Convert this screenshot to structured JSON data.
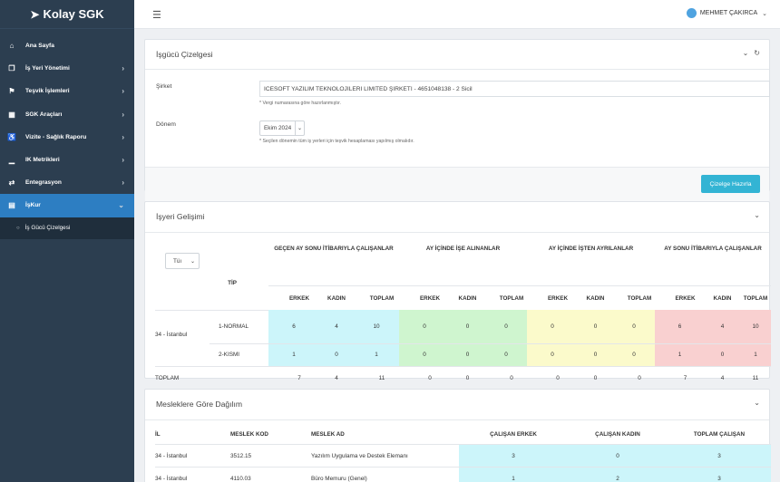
{
  "brand": {
    "name": "Kolay SGK"
  },
  "sidebar": {
    "items": [
      {
        "label": "Ana Sayfa",
        "icon": "home-icon",
        "glyph": "⌂",
        "has_chevron": false
      },
      {
        "label": "İş Yeri Yönetimi",
        "icon": "clipboard-icon",
        "glyph": "❐",
        "has_chevron": true
      },
      {
        "label": "Teşvik İşlemleri",
        "icon": "person-icon",
        "glyph": "⚑",
        "has_chevron": true
      },
      {
        "label": "SGK Araçları",
        "icon": "building-icon",
        "glyph": "▦",
        "has_chevron": true
      },
      {
        "label": "Vizite - Sağlık Raporu",
        "icon": "wheelchair-icon",
        "glyph": "♿",
        "has_chevron": true
      },
      {
        "label": "IK Metrikleri",
        "icon": "chart-icon",
        "glyph": "▁",
        "has_chevron": true
      },
      {
        "label": "Entegrasyon",
        "icon": "exchange-icon",
        "glyph": "⇄",
        "has_chevron": true
      },
      {
        "label": "İşKur",
        "icon": "idcard-icon",
        "glyph": "▤",
        "has_chevron": true,
        "active": true
      }
    ],
    "sub_items": [
      {
        "label": "İş Gücü Çizelgesi"
      }
    ]
  },
  "header": {
    "user_name": "MEHMET ÇAKIRCA"
  },
  "panel1": {
    "title": "İşgücü Çizelgesi",
    "company_label": "Şirket",
    "company_value": "ICESOFT YAZILIM TEKNOLOJILERI LIMITED ŞIRKETI - 4651048138 - 2 Sicil",
    "company_hint": "* Vergi numarasına göre hazırlanmıştır.",
    "period_label": "Dönem",
    "period_value": "Ekim 2024",
    "period_hint": "* Seçilen dönemin tüm iş yerleri için teşvik hesaplaması yapılmış olmalıdır.",
    "prepare_button": "Çizelge Hazırla"
  },
  "panel2": {
    "title": "İşyeri Gelişimi",
    "filter_value": "Tüı",
    "type_header": "TİP",
    "groups": [
      "GEÇEN AY SONU İTİBARIYLA ÇALIŞANLAR",
      "AY İÇİNDE İŞE ALINANLAR",
      "AY İÇİNDE İŞTEN AYRILANLAR",
      "AY SONU İTİBARIYLA ÇALIŞANLAR"
    ],
    "subheaders": [
      "ERKEK",
      "KADIN",
      "TOPLAM"
    ],
    "location": "34 - İstanbul",
    "rows": [
      {
        "type": "1-NORMAL",
        "values": [
          "6",
          "4",
          "10",
          "0",
          "0",
          "0",
          "0",
          "0",
          "0",
          "6",
          "4",
          "10"
        ]
      },
      {
        "type": "2-KISMI",
        "values": [
          "1",
          "0",
          "1",
          "0",
          "0",
          "0",
          "0",
          "0",
          "0",
          "1",
          "0",
          "1"
        ]
      }
    ],
    "total_label": "TOPLAM",
    "totals": [
      "7",
      "4",
      "11",
      "0",
      "0",
      "0",
      "0",
      "0",
      "0",
      "7",
      "4",
      "11"
    ],
    "group_colors": [
      "#ccf5fa",
      "#cff5cf",
      "#fbfacb",
      "#f9d0d0"
    ]
  },
  "panel3": {
    "title": "Mesleklere Göre Dağılım",
    "headers": [
      "İL",
      "MESLEK KOD",
      "MESLEK AD",
      "ÇALIŞAN ERKEK",
      "ÇALIŞAN KADIN",
      "TOPLAM ÇALIŞAN"
    ],
    "rows": [
      [
        "34 - İstanbul",
        "3512.15",
        "Yazılım Uygulama ve Destek Elemanı",
        "3",
        "0",
        "3"
      ],
      [
        "34 - İstanbul",
        "4110.03",
        "Büro Memuru (Genel)",
        "1",
        "2",
        "3"
      ]
    ],
    "highlight_color": "#ccf5fa"
  }
}
